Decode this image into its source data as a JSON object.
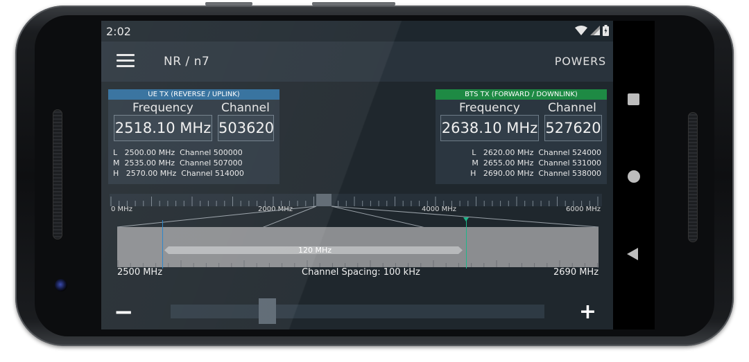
{
  "status_bar": {
    "time": "2:02"
  },
  "app_bar": {
    "title": "NR / n7",
    "action": "POWERS"
  },
  "ue_panel": {
    "header": "UE TX (REVERSE / UPLINK)",
    "frequency_label": "Frequency",
    "channel_label": "Channel",
    "frequency_value": "2518.10 MHz",
    "channel_value": "503620",
    "rows": [
      "L   2500.00 MHz  Channel 500000",
      "M  2535.00 MHz  Channel 507000",
      "H   2570.00 MHz  Channel 514000"
    ]
  },
  "bts_panel": {
    "header": "BTS TX (FORWARD / DOWNLINK)",
    "frequency_label": "Frequency",
    "channel_label": "Channel",
    "frequency_value": "2638.10 MHz",
    "channel_value": "527620",
    "rows": [
      "L   2620.00 MHz  Channel 524000",
      "M  2655.00 MHz  Channel 531000",
      "H   2690.00 MHz  Channel 538000"
    ]
  },
  "spectrum": {
    "ruler_labels": [
      "0 MHz",
      "2000 MHz",
      "4000 MHz",
      "6000 MHz"
    ],
    "span_label": "120 MHz",
    "zoom_left": "2500 MHz",
    "zoom_center": "Channel Spacing: 100 kHz",
    "zoom_right": "2690 MHz"
  },
  "controls": {
    "minus": "−",
    "plus": "+"
  },
  "icons": [
    "menu-icon",
    "wifi-icon",
    "signal-icon",
    "battery-icon",
    "square-icon",
    "circle-icon",
    "back-icon"
  ]
}
